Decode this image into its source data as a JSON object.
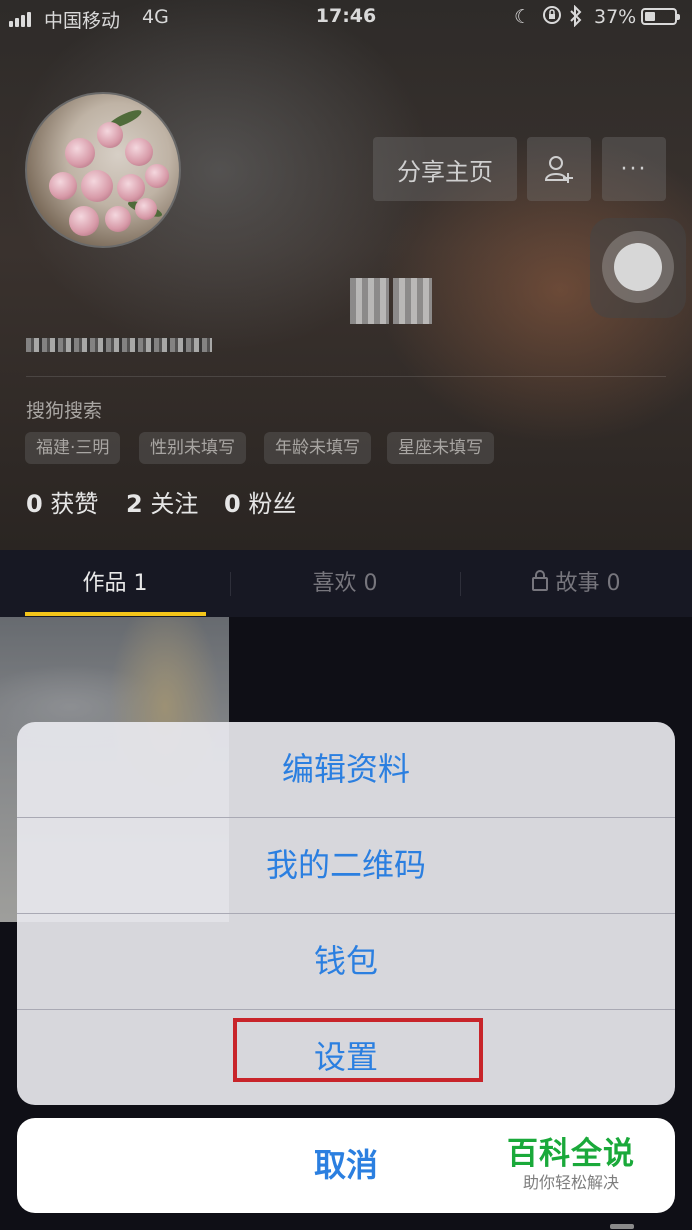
{
  "status_bar": {
    "carrier": "中国移动",
    "network": "4G",
    "time": "17:46",
    "battery_percent": "37%",
    "battery_level": 0.37,
    "icons": [
      "signal-icon",
      "moon-icon",
      "rotation-lock-icon",
      "bluetooth-icon",
      "battery-icon"
    ]
  },
  "profile": {
    "bio": "搜狗搜索",
    "tags": [
      "福建·三明",
      "性别未填写",
      "年龄未填写",
      "星座未填写"
    ],
    "stats": [
      {
        "count": "0",
        "label": "获赞"
      },
      {
        "count": "2",
        "label": "关注"
      },
      {
        "count": "0",
        "label": "粉丝"
      }
    ]
  },
  "header_actions": {
    "share_label": "分享主页",
    "add_friend_icon": "add-user-icon",
    "more_label": "···"
  },
  "tabs": [
    {
      "label": "作品 1",
      "active": true
    },
    {
      "label": "喜欢 0",
      "active": false
    },
    {
      "label": "故事 0",
      "active": false,
      "icon": "lock-icon"
    }
  ],
  "action_sheet": {
    "items": [
      "编辑资料",
      "我的二维码",
      "钱包",
      "设置"
    ],
    "highlighted": "设置",
    "cancel_label": "取消"
  },
  "watermark": {
    "title": "百科全说",
    "subtitle": "助你轻松解决"
  },
  "colors": {
    "accent_blue": "#2b7fe0",
    "tab_indicator": "#f4c51a",
    "highlight_red": "#c8242a",
    "watermark_green": "#1aa93a"
  }
}
